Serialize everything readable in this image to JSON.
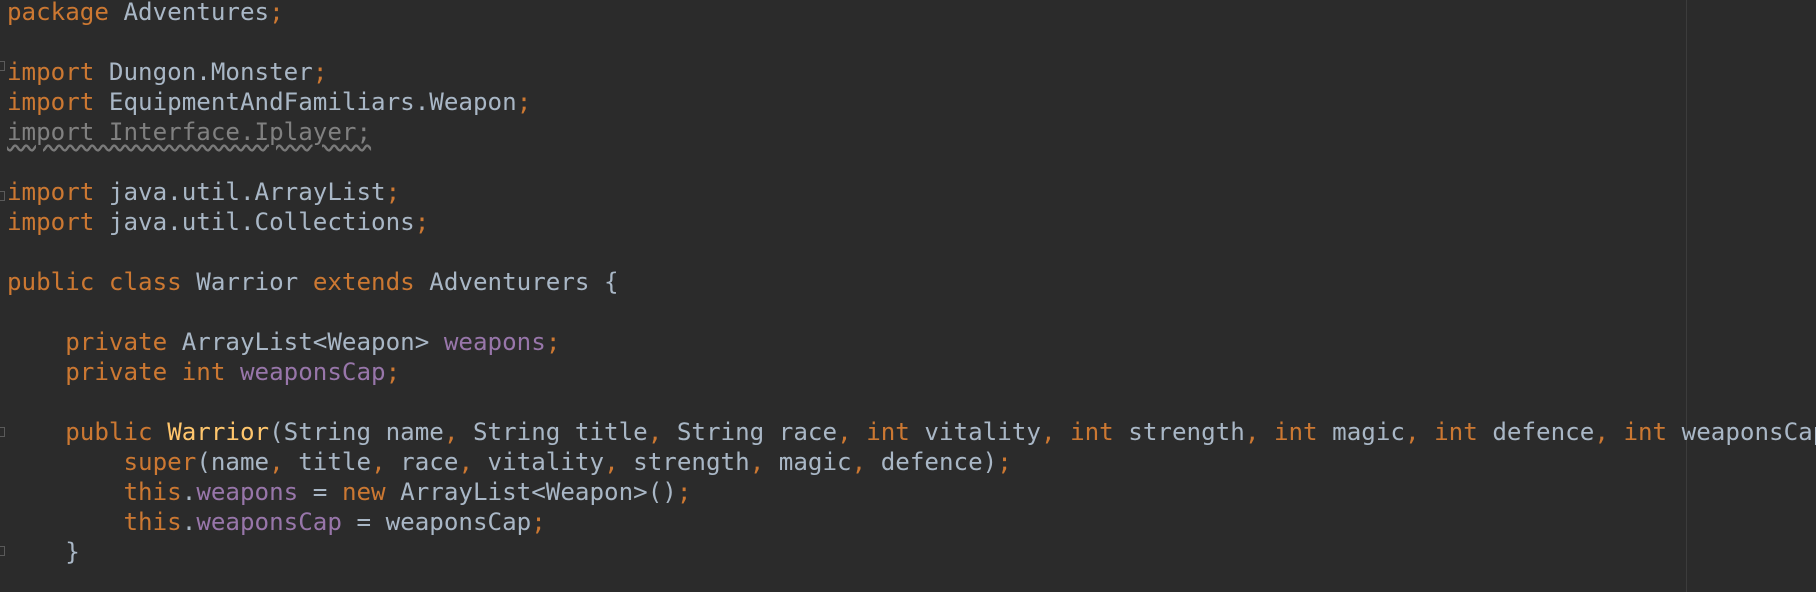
{
  "editor": {
    "language": "java",
    "theme_colors": {
      "background": "#2b2b2b",
      "default_text": "#a9b7c6",
      "keyword": "#cc7832",
      "field": "#9876aa",
      "method_declaration": "#ffc66d",
      "unused_import": "#808080"
    },
    "lines": [
      {
        "tokens": [
          {
            "t": "package",
            "c": "kw"
          },
          {
            "t": " Adventures"
          },
          {
            "t": ";",
            "c": "punc"
          }
        ]
      },
      {
        "tokens": []
      },
      {
        "tokens": [
          {
            "t": "import",
            "c": "kw"
          },
          {
            "t": " Dungon.Monster"
          },
          {
            "t": ";",
            "c": "punc"
          }
        ]
      },
      {
        "tokens": [
          {
            "t": "import",
            "c": "kw"
          },
          {
            "t": " EquipmentAndFamiliars.Weapon"
          },
          {
            "t": ";",
            "c": "punc"
          }
        ]
      },
      {
        "tokens": [
          {
            "t": "import Interface.Iplayer;",
            "c": "unused"
          }
        ]
      },
      {
        "tokens": []
      },
      {
        "tokens": [
          {
            "t": "import",
            "c": "kw"
          },
          {
            "t": " java.util.ArrayList"
          },
          {
            "t": ";",
            "c": "punc"
          }
        ]
      },
      {
        "tokens": [
          {
            "t": "import",
            "c": "kw"
          },
          {
            "t": " java.util.Collections"
          },
          {
            "t": ";",
            "c": "punc"
          }
        ]
      },
      {
        "tokens": []
      },
      {
        "tokens": [
          {
            "t": "public class",
            "c": "kw"
          },
          {
            "t": " Warrior "
          },
          {
            "t": "extends",
            "c": "kw"
          },
          {
            "t": " Adventurers {"
          }
        ]
      },
      {
        "tokens": []
      },
      {
        "tokens": [
          {
            "t": "    "
          },
          {
            "t": "private",
            "c": "kw"
          },
          {
            "t": " ArrayList<Weapon> "
          },
          {
            "t": "weapons",
            "c": "fld"
          },
          {
            "t": ";",
            "c": "punc"
          }
        ]
      },
      {
        "tokens": [
          {
            "t": "    "
          },
          {
            "t": "private int",
            "c": "kw"
          },
          {
            "t": " "
          },
          {
            "t": "weaponsCap",
            "c": "fld"
          },
          {
            "t": ";",
            "c": "punc"
          }
        ]
      },
      {
        "tokens": []
      },
      {
        "tokens": [
          {
            "t": "    "
          },
          {
            "t": "public",
            "c": "kw"
          },
          {
            "t": " "
          },
          {
            "t": "Warrior",
            "c": "fn"
          },
          {
            "t": "(String name"
          },
          {
            "t": ",",
            "c": "punc"
          },
          {
            "t": " String title"
          },
          {
            "t": ",",
            "c": "punc"
          },
          {
            "t": " String race"
          },
          {
            "t": ",",
            "c": "punc"
          },
          {
            "t": " "
          },
          {
            "t": "int",
            "c": "kw"
          },
          {
            "t": " vitality"
          },
          {
            "t": ",",
            "c": "punc"
          },
          {
            "t": " "
          },
          {
            "t": "int",
            "c": "kw"
          },
          {
            "t": " strength"
          },
          {
            "t": ",",
            "c": "punc"
          },
          {
            "t": " "
          },
          {
            "t": "int",
            "c": "kw"
          },
          {
            "t": " magic"
          },
          {
            "t": ",",
            "c": "punc"
          },
          {
            "t": " "
          },
          {
            "t": "int",
            "c": "kw"
          },
          {
            "t": " defence"
          },
          {
            "t": ",",
            "c": "punc"
          },
          {
            "t": " "
          },
          {
            "t": "int",
            "c": "kw"
          },
          {
            "t": " weaponsCap) {"
          }
        ]
      },
      {
        "tokens": [
          {
            "t": "        "
          },
          {
            "t": "super",
            "c": "kw"
          },
          {
            "t": "(name"
          },
          {
            "t": ",",
            "c": "punc"
          },
          {
            "t": " title"
          },
          {
            "t": ",",
            "c": "punc"
          },
          {
            "t": " race"
          },
          {
            "t": ",",
            "c": "punc"
          },
          {
            "t": " vitality"
          },
          {
            "t": ",",
            "c": "punc"
          },
          {
            "t": " strength"
          },
          {
            "t": ",",
            "c": "punc"
          },
          {
            "t": " magic"
          },
          {
            "t": ",",
            "c": "punc"
          },
          {
            "t": " defence)"
          },
          {
            "t": ";",
            "c": "punc"
          }
        ]
      },
      {
        "tokens": [
          {
            "t": "        "
          },
          {
            "t": "this",
            "c": "kw"
          },
          {
            "t": "."
          },
          {
            "t": "weapons",
            "c": "fld"
          },
          {
            "t": " = "
          },
          {
            "t": "new",
            "c": "kw"
          },
          {
            "t": " ArrayList<Weapon>()"
          },
          {
            "t": ";",
            "c": "punc"
          }
        ]
      },
      {
        "tokens": [
          {
            "t": "        "
          },
          {
            "t": "this",
            "c": "kw"
          },
          {
            "t": "."
          },
          {
            "t": "weaponsCap",
            "c": "fld"
          },
          {
            "t": " = weaponsCap"
          },
          {
            "t": ";",
            "c": "punc"
          }
        ]
      },
      {
        "tokens": [
          {
            "t": "    }"
          }
        ]
      }
    ]
  }
}
